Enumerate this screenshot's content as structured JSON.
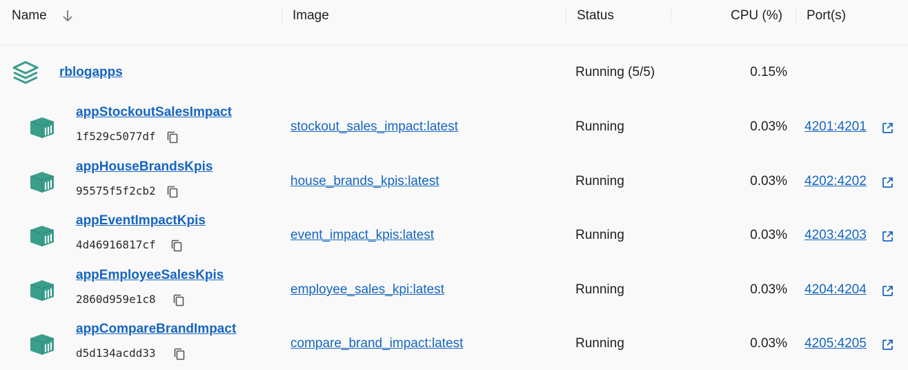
{
  "columns": {
    "name": "Name",
    "image": "Image",
    "status": "Status",
    "cpu": "CPU (%)",
    "ports": "Port(s)"
  },
  "group": {
    "name": "rblogapps",
    "status": "Running (5/5)",
    "cpu": "0.15%"
  },
  "containers": [
    {
      "name": "appStockoutSalesImpact",
      "id": "1f529c5077df",
      "image": "stockout_sales_impact:latest",
      "status": "Running",
      "cpu": "0.03%",
      "port": "4201:4201"
    },
    {
      "name": "appHouseBrandsKpis",
      "id": "95575f5f2cb2",
      "image": "house_brands_kpis:latest",
      "status": "Running",
      "cpu": "0.03%",
      "port": "4202:4202"
    },
    {
      "name": "appEventImpactKpis",
      "id": "4d46916817cf",
      "image": "event_impact_kpis:latest",
      "status": "Running",
      "cpu": "0.03%",
      "port": "4203:4203"
    },
    {
      "name": "appEmployeeSalesKpis",
      "id": "2860d959e1c8",
      "image": "employee_sales_kpi:latest",
      "status": "Running",
      "cpu": "0.03%",
      "port": "4204:4204"
    },
    {
      "name": "appCompareBrandImpact",
      "id": "d5d134acdd33",
      "image": "compare_brand_impact:latest",
      "status": "Running",
      "cpu": "0.03%",
      "port": "4205:4205"
    }
  ],
  "colors": {
    "accent": "#1565c0",
    "icon_teal": "#3a9e8c"
  },
  "icons": {
    "sort": "arrow-down-icon",
    "group": "stack-layers-icon",
    "container": "container-icon",
    "copy": "copy-icon",
    "external": "external-link-icon"
  }
}
